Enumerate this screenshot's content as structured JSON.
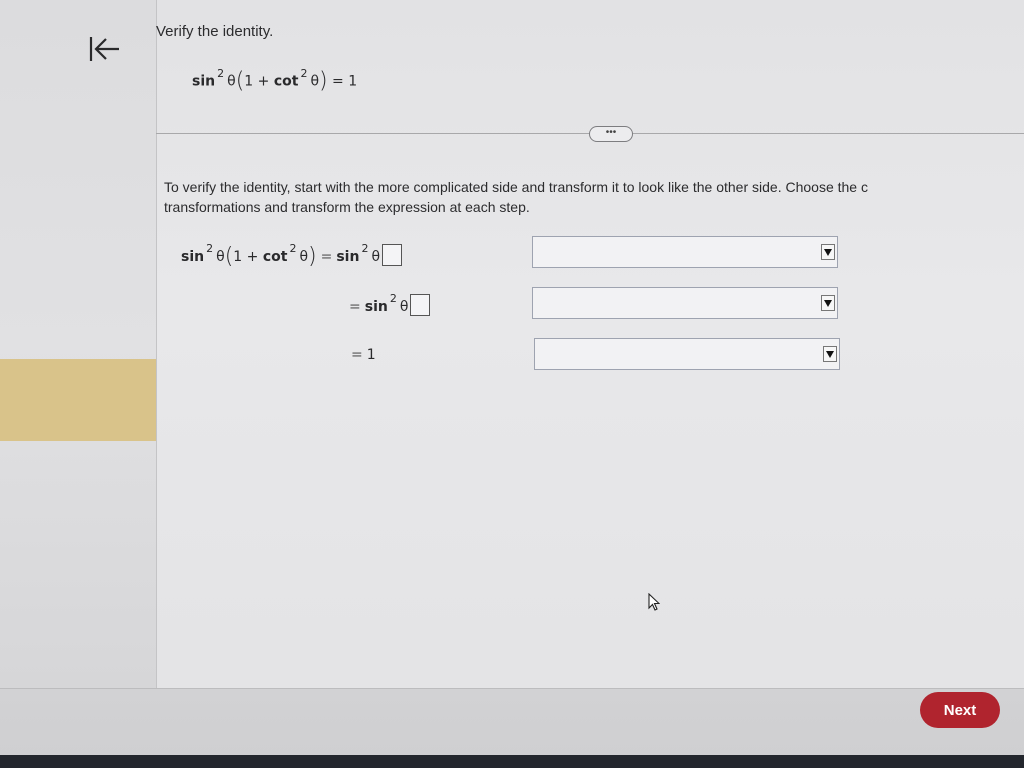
{
  "sidebar": {
    "collapse_icon": "collapse-left-arrow-icon"
  },
  "question": {
    "title": "Verify the identity.",
    "identity": {
      "fn1": "sin",
      "exp1": "2",
      "var1": "θ",
      "open": "(",
      "one": "1 + ",
      "fn2": "cot",
      "exp2": "2",
      "var2": "θ",
      "close": ")",
      "rhs": " = 1"
    },
    "more_label": "•••"
  },
  "instructions": {
    "line1": "To verify the identity, start with the more complicated side and transform it to look like the other side. Choose the c",
    "line2": "transformations and transform the expression at each step."
  },
  "steps": [
    {
      "lhs_fn1": "sin",
      "lhs_exp1": "2",
      "lhs_var1": "θ",
      "lhs_open": "(",
      "lhs_one": "1 + ",
      "lhs_fn2": "cot",
      "lhs_exp2": "2",
      "lhs_var2": "θ",
      "lhs_close": ")",
      "eq": "=",
      "fn": "sin",
      "exp": "2",
      "var": "θ",
      "answer_value": ""
    },
    {
      "eq": "=",
      "fn": "sin",
      "exp": "2",
      "var": "θ",
      "answer_value": ""
    },
    {
      "eq": "=",
      "value": "1"
    }
  ],
  "dropdowns": [
    {
      "selected": ""
    },
    {
      "selected": ""
    },
    {
      "selected": ""
    }
  ],
  "footer": {
    "next_label": "Next"
  },
  "colors": {
    "next_button": "#b0242e",
    "rail_highlight": "#d9c38a"
  }
}
